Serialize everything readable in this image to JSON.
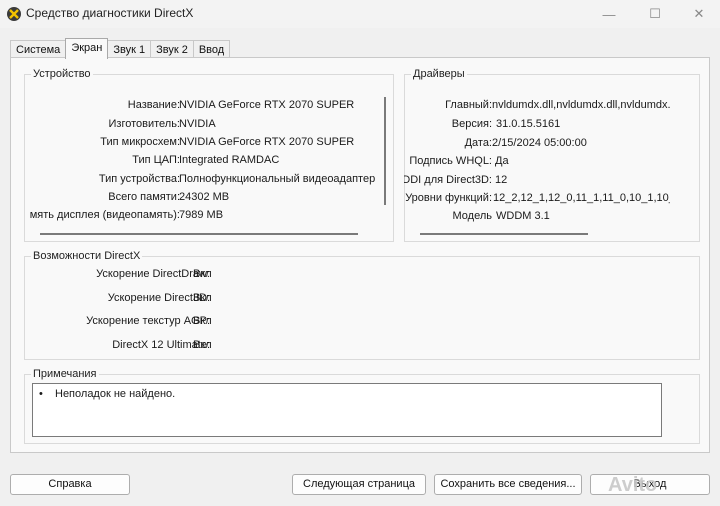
{
  "window": {
    "title": "Средство диагностики DirectX",
    "min_glyph": "—",
    "max_glyph": "☐",
    "close_glyph": "✕"
  },
  "tabs": [
    {
      "label": "Система"
    },
    {
      "label": "Экран"
    },
    {
      "label": "Звук 1"
    },
    {
      "label": "Звук 2"
    },
    {
      "label": "Ввод"
    }
  ],
  "device": {
    "title": "Устройство",
    "rows": [
      {
        "label": "Название:",
        "value": "NVIDIA GeForce RTX 2070 SUPER"
      },
      {
        "label": "Изготовитель:",
        "value": "NVIDIA"
      },
      {
        "label": "Тип микросхем:",
        "value": "NVIDIA GeForce RTX 2070 SUPER"
      },
      {
        "label": "Тип ЦАП:",
        "value": "Integrated RAMDAC"
      },
      {
        "label": "Тип устройства:",
        "value": "Полнофункциональный видеоадаптер"
      },
      {
        "label": "Всего памяти:",
        "value": "24302 MB"
      },
      {
        "label": "мять дисплея (видеопамять):",
        "value": "7989 MB"
      }
    ]
  },
  "drivers": {
    "title": "Драйверы",
    "rows": [
      {
        "label": "Главный:",
        "value": "nvldumdx.dll,nvldumdx.dll,nvldumdx.c"
      },
      {
        "label": "Версия:",
        "value": "31.0.15.5161"
      },
      {
        "label": "Дата:",
        "value": "2/15/2024 05:00:00"
      },
      {
        "label": "Подпись WHQL:",
        "value": "Да"
      },
      {
        "label": "DDI для Direct3D:",
        "value": "12"
      },
      {
        "label": "Уровни функций:",
        "value": "12_2,12_1,12_0,11_1,11_0,10_1,10_"
      },
      {
        "label": "Модель",
        "value": "WDDM 3.1"
      }
    ]
  },
  "directx": {
    "title": "Возможности DirectX",
    "rows": [
      {
        "label": "Ускорение DirectDraw:",
        "value": "Вкл"
      },
      {
        "label": "Ускорение Direct3D:",
        "value": "Вкл"
      },
      {
        "label": "Ускорение текстур AGP:",
        "value": "Вкл"
      },
      {
        "label": "DirectX 12 Ultimate:",
        "value": "Вкл"
      }
    ]
  },
  "notes": {
    "title": "Примечания",
    "items": [
      "Неполадок не найдено."
    ]
  },
  "buttons": {
    "help": "Справка",
    "next_page": "Следующая страница",
    "save_all": "Сохранить все сведения...",
    "exit": "Выход"
  },
  "watermark": "Avito",
  "colors": {
    "window_bg": "#f0f0f0",
    "panel_bg": "#f9f9f9",
    "border": "#c9c9c9"
  }
}
